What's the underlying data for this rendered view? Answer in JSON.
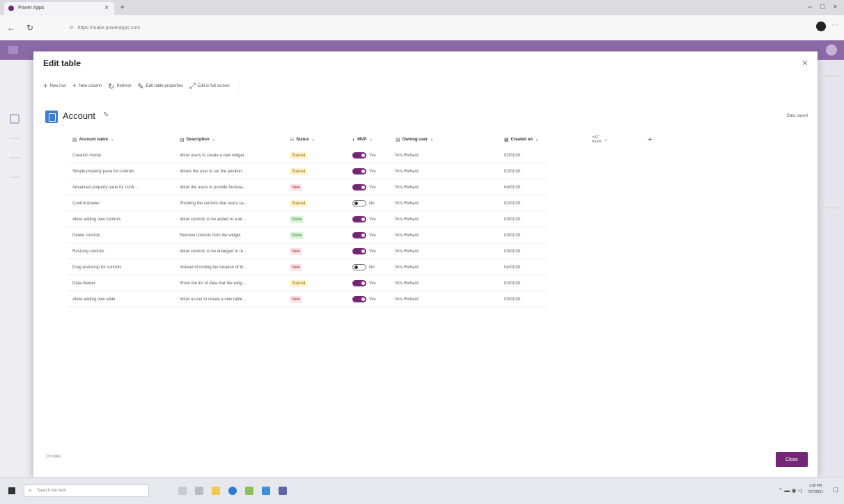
{
  "browser": {
    "tab_title": "Power Apps",
    "tab_close": "×",
    "new_tab": "+",
    "address": "https://make.powerapps.com",
    "back": "←",
    "refresh": "↻",
    "minimize": "–",
    "restore": "□",
    "close": "×"
  },
  "modal": {
    "title": "Edit table",
    "close_icon": "×",
    "commands": [
      {
        "icon": "+",
        "label": "New row"
      },
      {
        "icon": "+",
        "label": "New column"
      },
      {
        "icon": "↻",
        "label": "Refresh"
      },
      {
        "icon": "✎",
        "label": "Edit table properties"
      },
      {
        "icon": "⤢",
        "label": "Edit in full screen"
      }
    ],
    "table_name": "Account",
    "save_status": "Data saved",
    "row_count": "10 rows",
    "close_button": "Close"
  },
  "grid": {
    "columns": [
      {
        "icon": "▤",
        "label": "Account name"
      },
      {
        "icon": "▤",
        "label": "Description"
      },
      {
        "icon": "☷",
        "label": "Status"
      },
      {
        "icon": "◐",
        "label": "MVP"
      },
      {
        "icon": "▤",
        "label": "Owning user"
      },
      {
        "icon": "▦",
        "label": "Created on"
      }
    ],
    "more_fields": "+47 more",
    "add_column": "+",
    "rows": [
      {
        "name": "Creation modal",
        "desc": "Allow users to create a new widget",
        "status": "Started",
        "mvp": true,
        "mvp_label": "Yes",
        "owner": "Kris Richard",
        "created": "02/01/20"
      },
      {
        "name": "Simple property pane for controls",
        "desc": "Allows the user to set the position…",
        "status": "Started",
        "mvp": true,
        "mvp_label": "Yes",
        "owner": "Kris Richard",
        "created": "02/01/20"
      },
      {
        "name": "Advanced property pane for contr…",
        "desc": "Allow the users to provide formula…",
        "status": "New",
        "mvp": true,
        "mvp_label": "Yes",
        "owner": "Kris Richard",
        "created": "04/01/20"
      },
      {
        "name": "Control drawer",
        "desc": "Showing the controls that users ca…",
        "status": "Started",
        "mvp": false,
        "mvp_label": "No",
        "owner": "Kris Richard",
        "created": "02/01/20"
      },
      {
        "name": "Allow adding new controls",
        "desc": "Allow controls to be added to a wi…",
        "status": "Done",
        "mvp": true,
        "mvp_label": "Yes",
        "owner": "Kris Richard",
        "created": "03/01/20"
      },
      {
        "name": "Delete controls",
        "desc": "Remove controls from the widget",
        "status": "Done",
        "mvp": true,
        "mvp_label": "Yes",
        "owner": "Kris Richard",
        "created": "03/01/20"
      },
      {
        "name": "Resizing controls",
        "desc": "Allow controls to be enlarged or re…",
        "status": "New",
        "mvp": true,
        "mvp_label": "Yes",
        "owner": "Kris Richard",
        "created": "03/01/20"
      },
      {
        "name": "Drag-and-drop for controls",
        "desc": "Instead of coding the location of th…",
        "status": "New",
        "mvp": false,
        "mvp_label": "No",
        "owner": "Kris Richard",
        "created": "04/01/20"
      },
      {
        "name": "Data drawer",
        "desc": "Show the list of data that the widg…",
        "status": "Started",
        "mvp": true,
        "mvp_label": "Yes",
        "owner": "Kris Richard",
        "created": "02/01/20"
      },
      {
        "name": "Allow adding new table",
        "desc": "Allow a user to create a new table …",
        "status": "New",
        "mvp": true,
        "mvp_label": "Yes",
        "owner": "Kris Richard",
        "created": "03/01/20"
      }
    ]
  },
  "taskbar": {
    "search_placeholder": "Search the web",
    "time": "1:08 PM",
    "date": "7/27/2021"
  },
  "colors": {
    "accent": "#742774",
    "appbar": "#8c6aa8",
    "table_icon": "#3b7fd4"
  }
}
